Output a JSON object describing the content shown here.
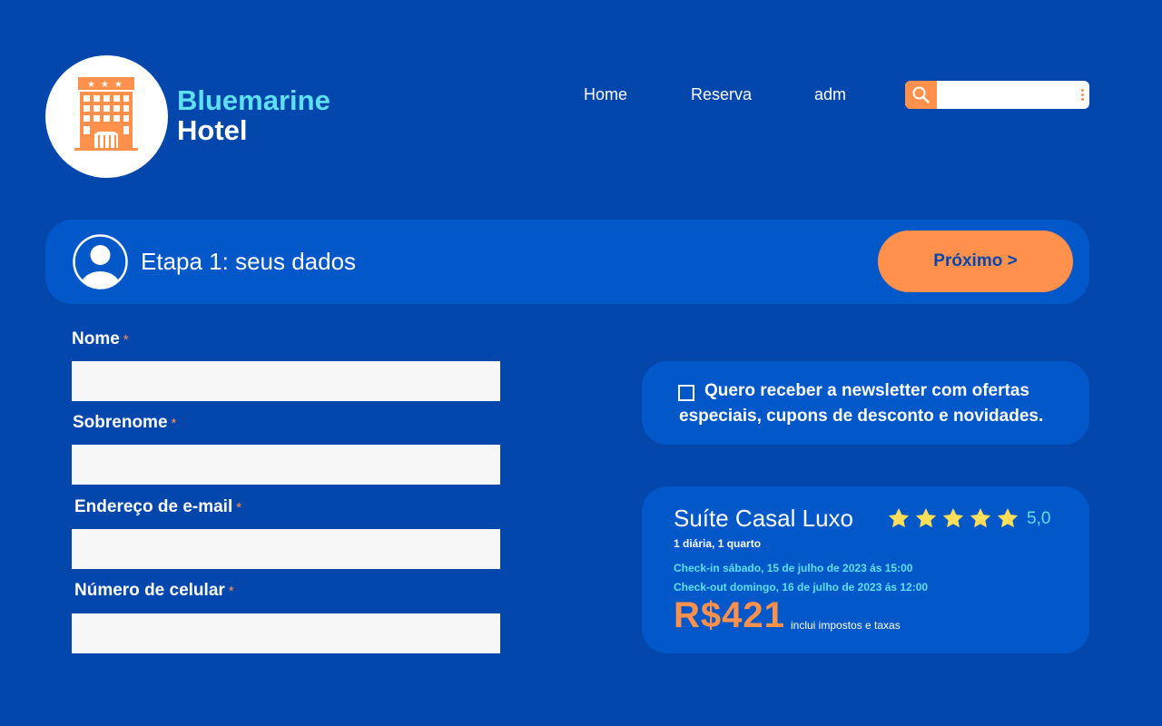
{
  "brand": {
    "line1": "Bluemarine",
    "line2": "Hotel",
    "logo_icon": "hotel-building-icon"
  },
  "nav": {
    "items": [
      "Home",
      "Reserva",
      "adm"
    ]
  },
  "search": {
    "icon": "search-icon",
    "value": "",
    "placeholder": ""
  },
  "step": {
    "title": "Etapa 1: seus dados",
    "avatar_icon": "user-avatar-icon",
    "next_label": "Próximo >"
  },
  "form": {
    "fields": [
      {
        "label": "Nome",
        "required": "*",
        "value": ""
      },
      {
        "label": "Sobrenome",
        "required": "*",
        "value": ""
      },
      {
        "label": "Endereço de e-mail",
        "required": "*",
        "value": ""
      },
      {
        "label": "Número de celular",
        "required": "*",
        "value": ""
      }
    ]
  },
  "newsletter": {
    "text": "Quero receber a newsletter com ofertas especiais, cupons de desconto e novidades.",
    "checked": false
  },
  "room": {
    "name": "Suíte Casal Luxo",
    "stars": 5,
    "rating": "5,0",
    "subtitle": "1 diária, 1 quarto",
    "checkin": "Check-in sábado, 15 de julho de 2023 ás 15:00",
    "checkout": "Check-out domingo, 16 de julho de 2023 ás 12:00",
    "price": "R$421",
    "price_note": "inclui impostos e taxas"
  },
  "colors": {
    "background": "#0347ad",
    "panel": "#0257c9",
    "accent": "#ff914d",
    "cyan": "#5ee0f2",
    "star": "#ffde59"
  }
}
